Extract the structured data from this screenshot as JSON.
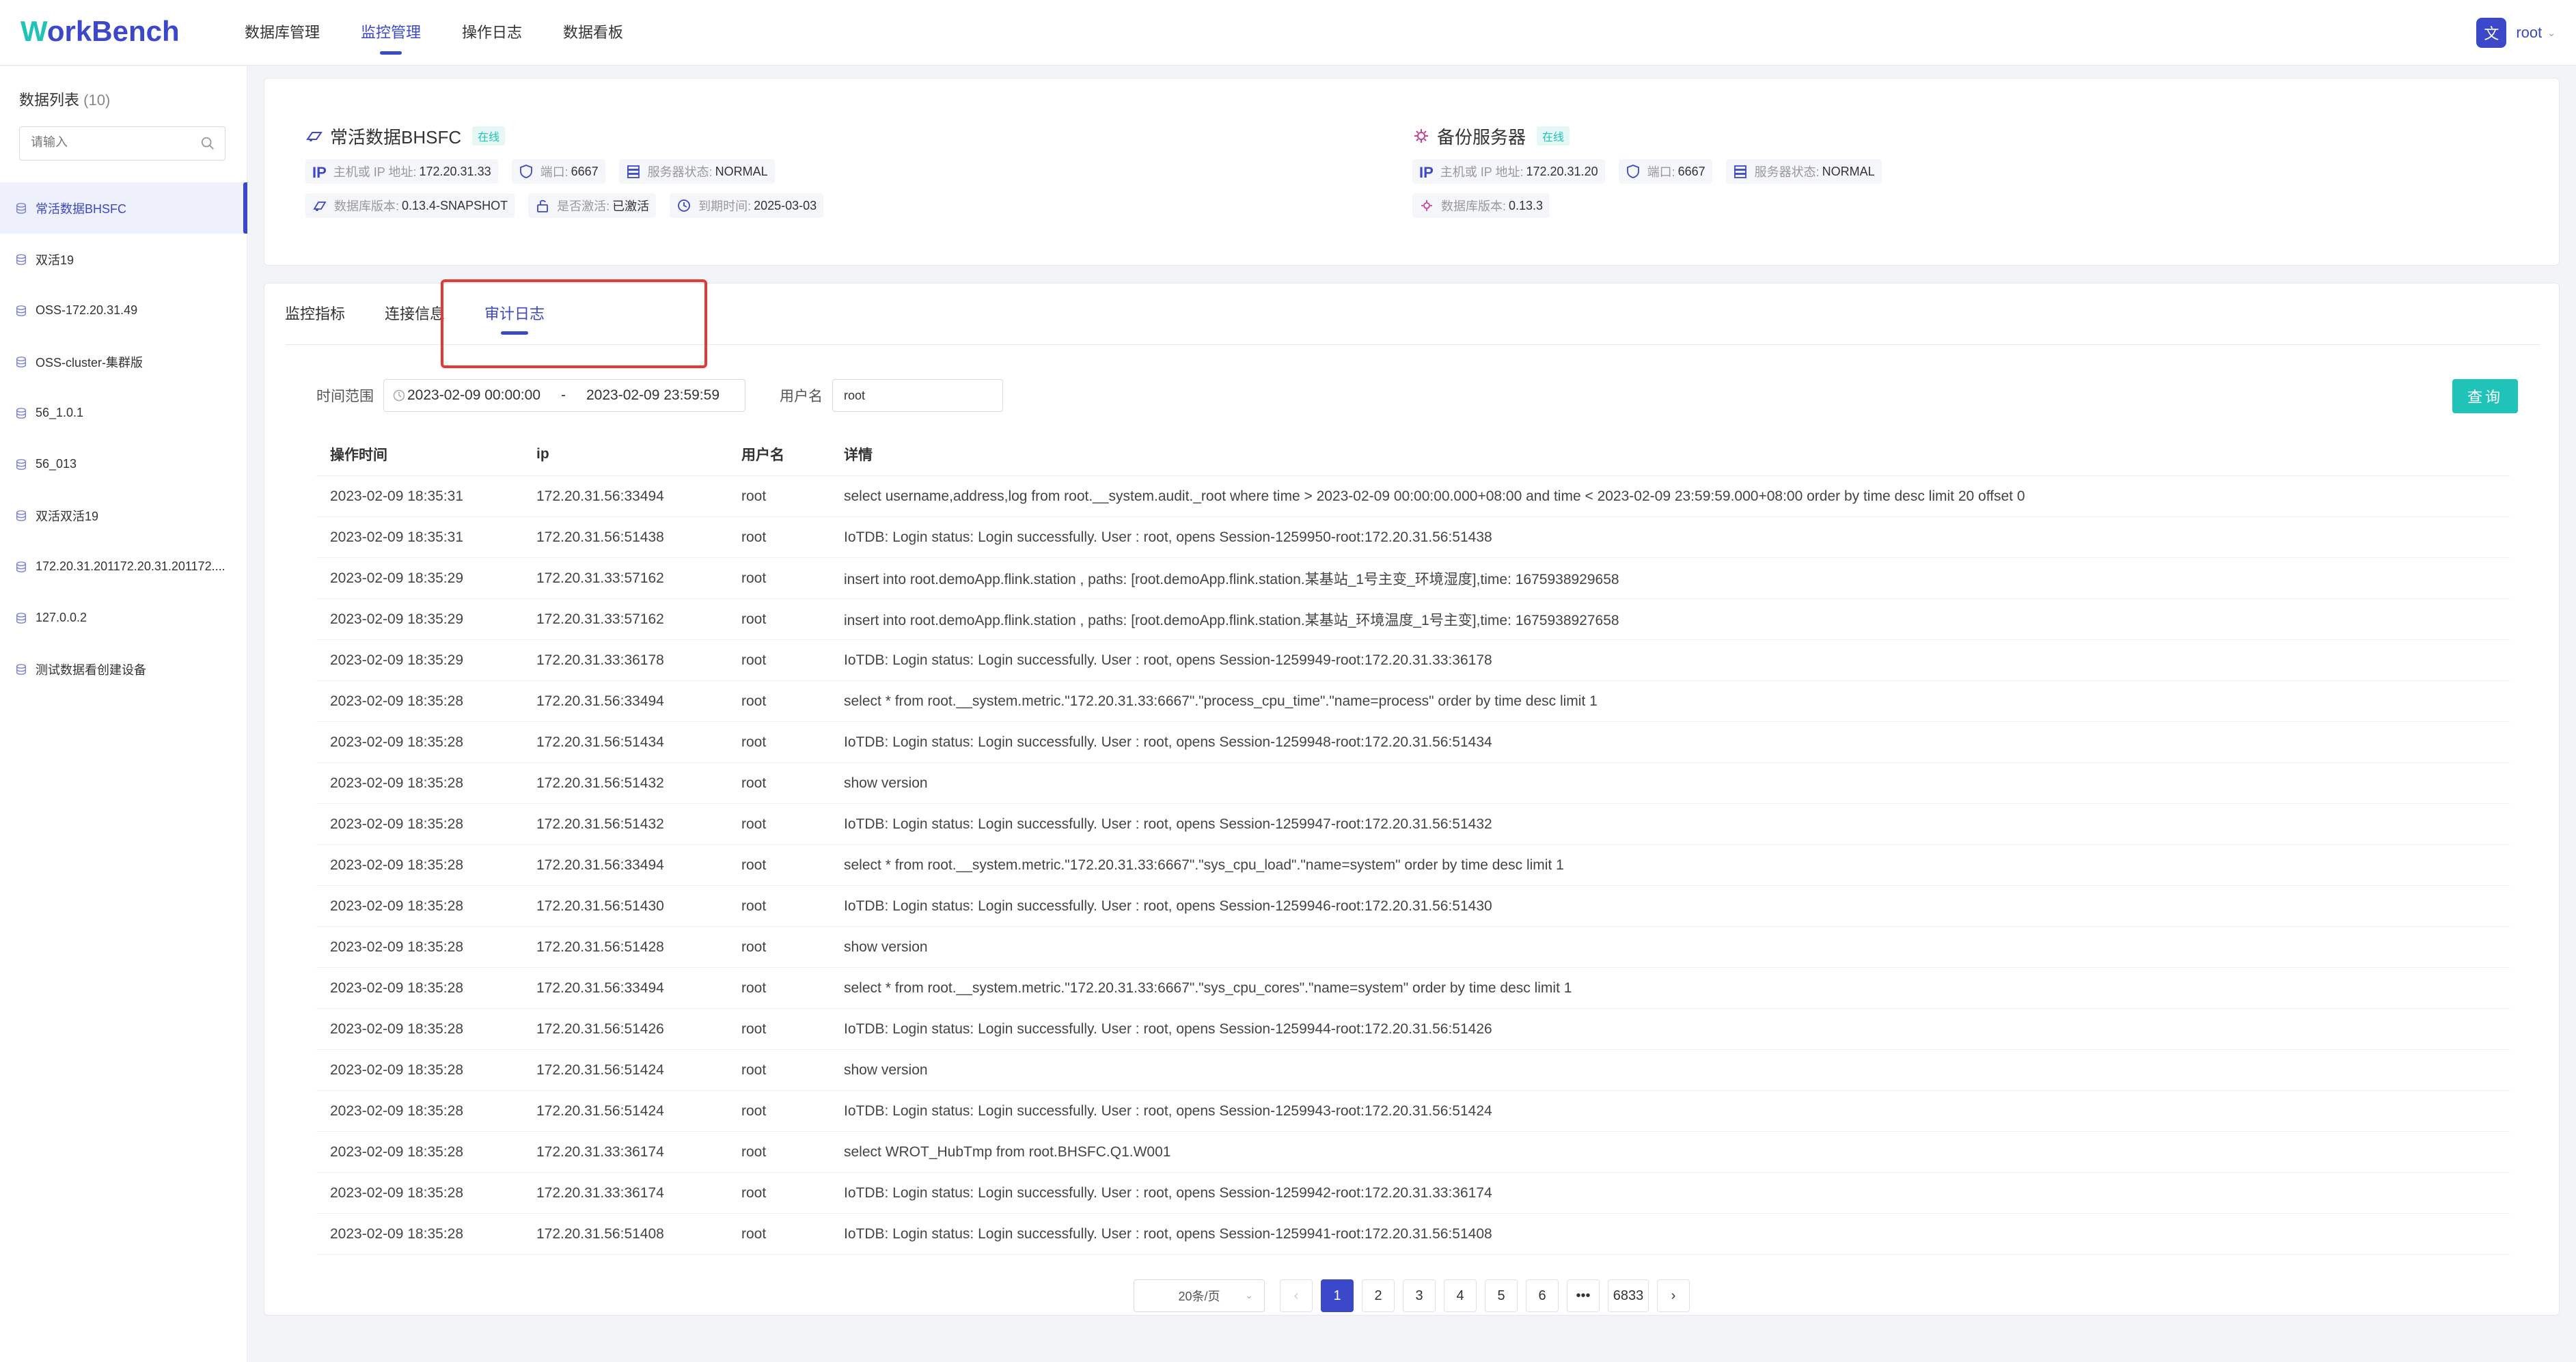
{
  "app": {
    "logo_w": "W",
    "logo_rest": "orkBench"
  },
  "nav": {
    "items": [
      {
        "label": "数据库管理"
      },
      {
        "label": "监控管理"
      },
      {
        "label": "操作日志"
      },
      {
        "label": "数据看板"
      }
    ],
    "active_index": 1
  },
  "user": {
    "lang_glyph": "文",
    "name": "root",
    "chevron": "⌄"
  },
  "sidebar": {
    "title": "数据列表",
    "count": "(10)",
    "search_placeholder": "请输入",
    "items": [
      {
        "label": "常活数据BHSFC"
      },
      {
        "label": "双活19"
      },
      {
        "label": "OSS-172.20.31.49"
      },
      {
        "label": "OSS-cluster-集群版"
      },
      {
        "label": "56_1.0.1"
      },
      {
        "label": "56_013"
      },
      {
        "label": "双活双活19"
      },
      {
        "label": "172.20.31.201172.20.31.201172...."
      },
      {
        "label": "127.0.0.2"
      },
      {
        "label": "测试数据看创建设备"
      }
    ]
  },
  "servers": {
    "primary": {
      "name": "常活数据BHSFC",
      "status": "在线",
      "host_key": "主机或 IP 地址:",
      "host": "172.20.31.33",
      "port_key": "端口:",
      "port": "6667",
      "state_key": "服务器状态:",
      "state": "NORMAL",
      "version_key": "数据库版本:",
      "version": "0.13.4-SNAPSHOT",
      "active_key": "是否激活:",
      "active": "已激活",
      "expire_key": "到期时间:",
      "expire": "2025-03-03"
    },
    "backup": {
      "name": "备份服务器",
      "status": "在线",
      "host_key": "主机或 IP 地址:",
      "host": "172.20.31.20",
      "port_key": "端口:",
      "port": "6667",
      "state_key": "服务器状态:",
      "state": "NORMAL",
      "version_key": "数据库版本:",
      "version": "0.13.3"
    },
    "ip_text": "IP"
  },
  "tabs": [
    {
      "label": "监控指标"
    },
    {
      "label": "连接信息"
    },
    {
      "label": "审计日志"
    }
  ],
  "filter": {
    "range_label": "时间范围",
    "start": "2023-02-09 00:00:00",
    "sep": "-",
    "end": "2023-02-09 23:59:59",
    "user_label": "用户名",
    "user_value": "root",
    "query_label": "查询"
  },
  "table": {
    "columns": [
      "操作时间",
      "ip",
      "用户名",
      "详情"
    ],
    "rows": [
      [
        "2023-02-09 18:35:31",
        "172.20.31.56:33494",
        "root",
        "select username,address,log from root.__system.audit._root where time > 2023-02-09 00:00:00.000+08:00 and time < 2023-02-09 23:59:59.000+08:00 order by time desc limit 20 offset 0"
      ],
      [
        "2023-02-09 18:35:31",
        "172.20.31.56:51438",
        "root",
        "IoTDB: Login status: Login successfully. User : root, opens Session-1259950-root:172.20.31.56:51438"
      ],
      [
        "2023-02-09 18:35:29",
        "172.20.31.33:57162",
        "root",
        "insert into root.demoApp.flink.station , paths: [root.demoApp.flink.station.某基站_1号主变_环境湿度],time: 1675938929658"
      ],
      [
        "2023-02-09 18:35:29",
        "172.20.31.33:57162",
        "root",
        "insert into root.demoApp.flink.station , paths: [root.demoApp.flink.station.某基站_环境温度_1号主变],time: 1675938927658"
      ],
      [
        "2023-02-09 18:35:29",
        "172.20.31.33:36178",
        "root",
        "IoTDB: Login status: Login successfully. User : root, opens Session-1259949-root:172.20.31.33:36178"
      ],
      [
        "2023-02-09 18:35:28",
        "172.20.31.56:33494",
        "root",
        "select * from root.__system.metric.\"172.20.31.33:6667\".\"process_cpu_time\".\"name=process\" order by time desc limit 1"
      ],
      [
        "2023-02-09 18:35:28",
        "172.20.31.56:51434",
        "root",
        "IoTDB: Login status: Login successfully. User : root, opens Session-1259948-root:172.20.31.56:51434"
      ],
      [
        "2023-02-09 18:35:28",
        "172.20.31.56:51432",
        "root",
        "show version"
      ],
      [
        "2023-02-09 18:35:28",
        "172.20.31.56:51432",
        "root",
        "IoTDB: Login status: Login successfully. User : root, opens Session-1259947-root:172.20.31.56:51432"
      ],
      [
        "2023-02-09 18:35:28",
        "172.20.31.56:33494",
        "root",
        "select * from root.__system.metric.\"172.20.31.33:6667\".\"sys_cpu_load\".\"name=system\" order by time desc limit 1"
      ],
      [
        "2023-02-09 18:35:28",
        "172.20.31.56:51430",
        "root",
        "IoTDB: Login status: Login successfully. User : root, opens Session-1259946-root:172.20.31.56:51430"
      ],
      [
        "2023-02-09 18:35:28",
        "172.20.31.56:51428",
        "root",
        "show version"
      ],
      [
        "2023-02-09 18:35:28",
        "172.20.31.56:33494",
        "root",
        "select * from root.__system.metric.\"172.20.31.33:6667\".\"sys_cpu_cores\".\"name=system\" order by time desc limit 1"
      ],
      [
        "2023-02-09 18:35:28",
        "172.20.31.56:51426",
        "root",
        "IoTDB: Login status: Login successfully. User : root, opens Session-1259944-root:172.20.31.56:51426"
      ],
      [
        "2023-02-09 18:35:28",
        "172.20.31.56:51424",
        "root",
        "show version"
      ],
      [
        "2023-02-09 18:35:28",
        "172.20.31.56:51424",
        "root",
        "IoTDB: Login status: Login successfully. User : root, opens Session-1259943-root:172.20.31.56:51424"
      ],
      [
        "2023-02-09 18:35:28",
        "172.20.31.33:36174",
        "root",
        "select WROT_HubTmp from root.BHSFC.Q1.W001"
      ],
      [
        "2023-02-09 18:35:28",
        "172.20.31.33:36174",
        "root",
        "IoTDB: Login status: Login successfully. User : root, opens Session-1259942-root:172.20.31.33:36174"
      ],
      [
        "2023-02-09 18:35:28",
        "172.20.31.56:51408",
        "root",
        "IoTDB: Login status: Login successfully. User : root, opens Session-1259941-root:172.20.31.56:51408"
      ]
    ]
  },
  "pagination": {
    "page_size": "20条/页",
    "prev": "‹",
    "next": "›",
    "pages": [
      "1",
      "2",
      "3",
      "4",
      "5",
      "6"
    ],
    "ellipsis": "•••",
    "last": "6833",
    "current": "1"
  },
  "colors": {
    "primary": "#3b48c9",
    "accent": "#20c3b8",
    "highlight": "#e53935"
  },
  "icons": {
    "database": "database-icon",
    "search": "search-icon",
    "clock": "clock-icon",
    "translate": "translate-icon"
  }
}
